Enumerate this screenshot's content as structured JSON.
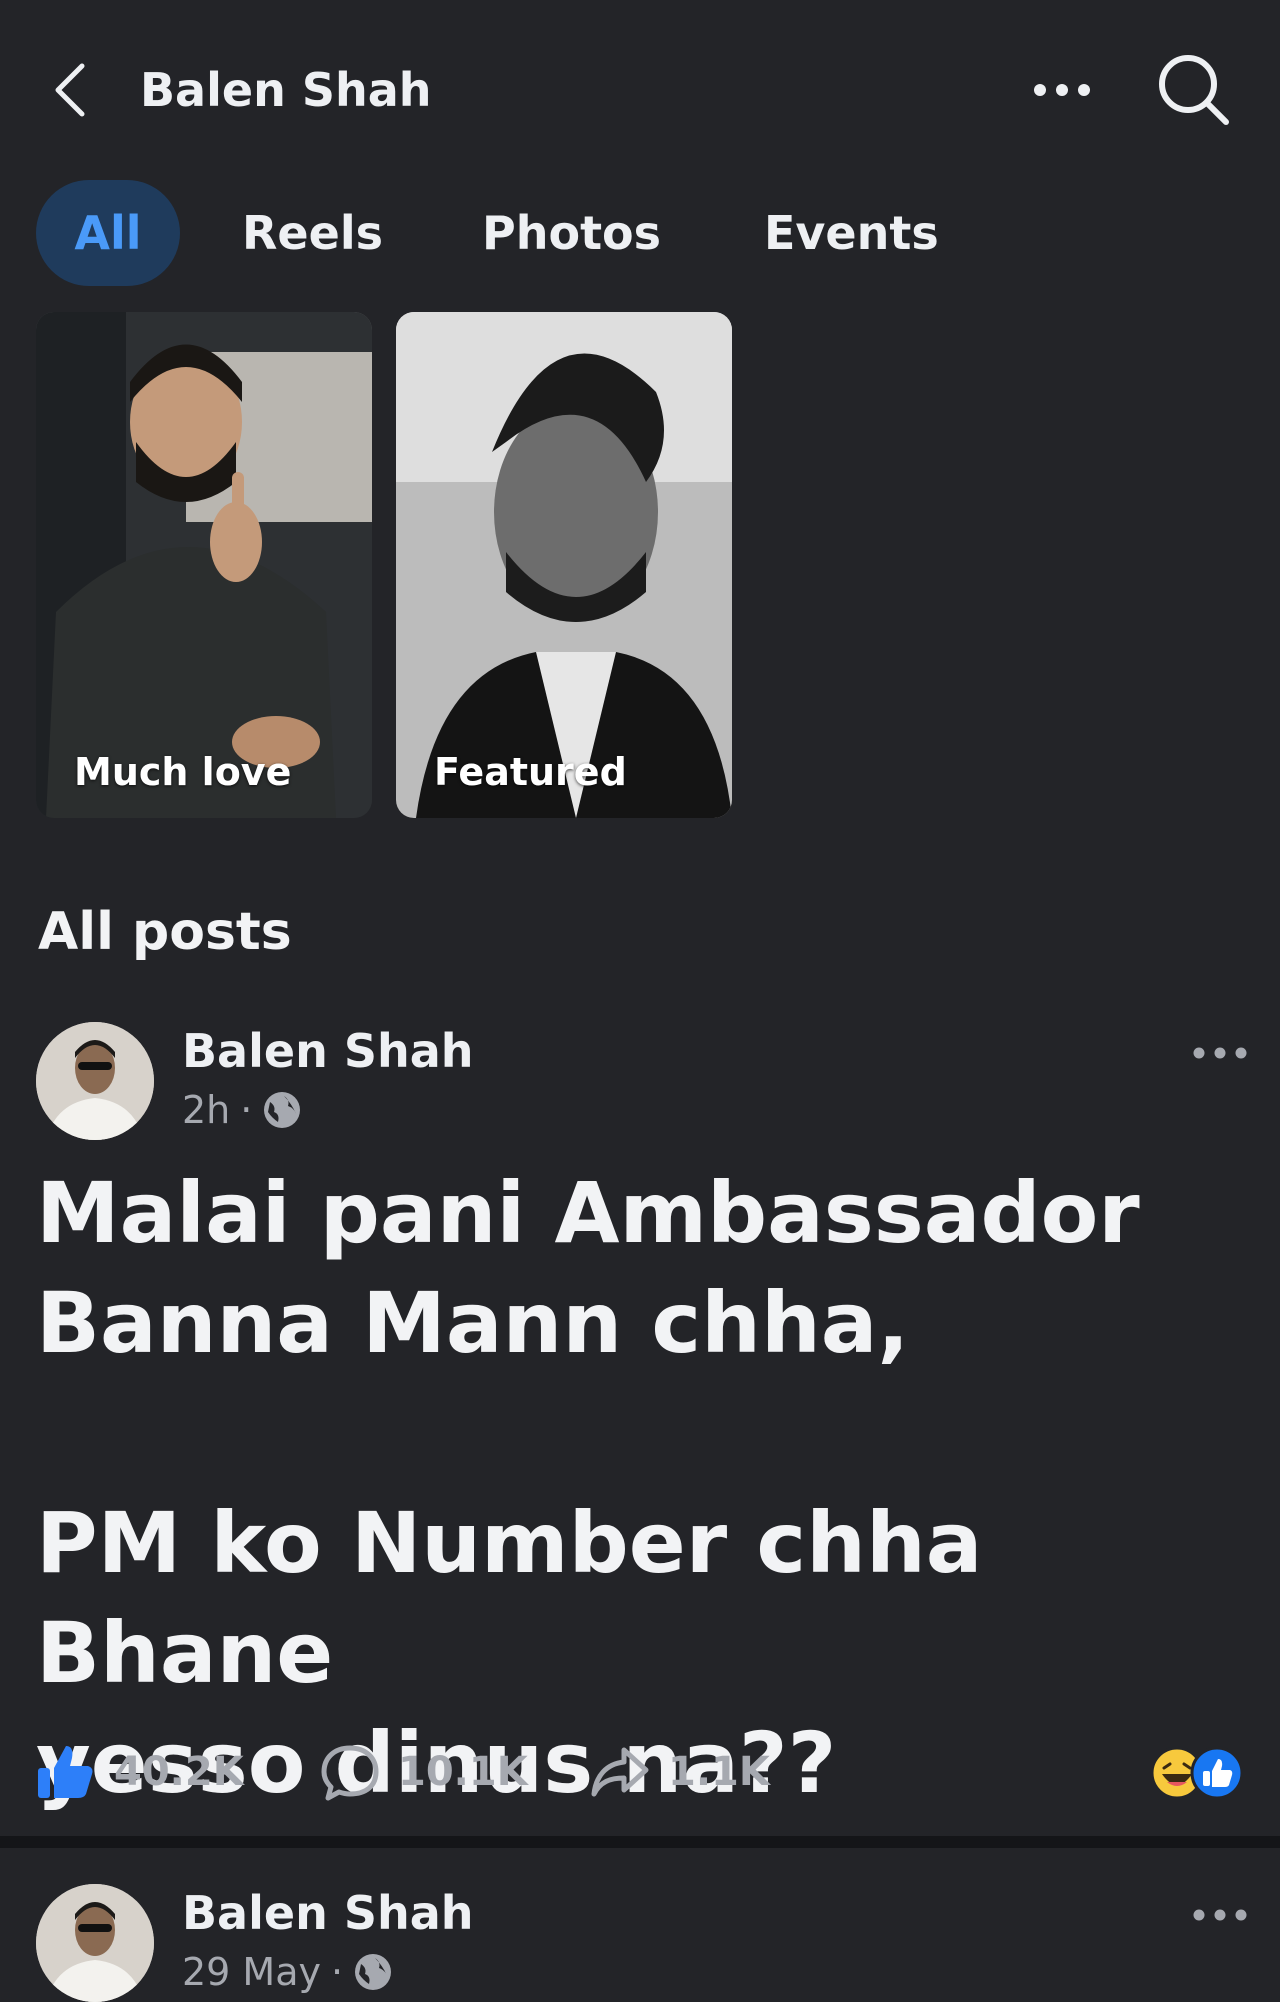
{
  "header": {
    "title": "Balen Shah",
    "back_icon": "chevron-left-icon",
    "more_icon": "more-horizontal-icon",
    "search_icon": "search-icon"
  },
  "tabs": [
    {
      "label": "All",
      "selected": true
    },
    {
      "label": "Reels",
      "selected": false
    },
    {
      "label": "Photos",
      "selected": false
    },
    {
      "label": "Events",
      "selected": false
    }
  ],
  "featured": [
    {
      "label": "Much love"
    },
    {
      "label": "Featured"
    }
  ],
  "section_title": "All posts",
  "posts": [
    {
      "author": "Balen Shah",
      "time": "2h",
      "separator": "·",
      "audience_icon": "globe-icon",
      "text_lines": [
        "Malai pani Ambassador",
        "Banna Mann chha,",
        "",
        "PM ko Number chha Bhane",
        "yesso dinus na??"
      ],
      "likes": "40.2K",
      "comments": "10.1K",
      "shares": "1.1K",
      "reactions": [
        "haha-reaction-icon",
        "like-reaction-icon"
      ]
    },
    {
      "author": "Balen Shah",
      "time": "29 May",
      "separator": "·",
      "audience_icon": "globe-icon"
    }
  ],
  "colors": {
    "background": "#232428",
    "accent": "#4a9af8",
    "selected_tab_bg": "#1f3b5c",
    "muted_text": "#a6a9b0"
  }
}
